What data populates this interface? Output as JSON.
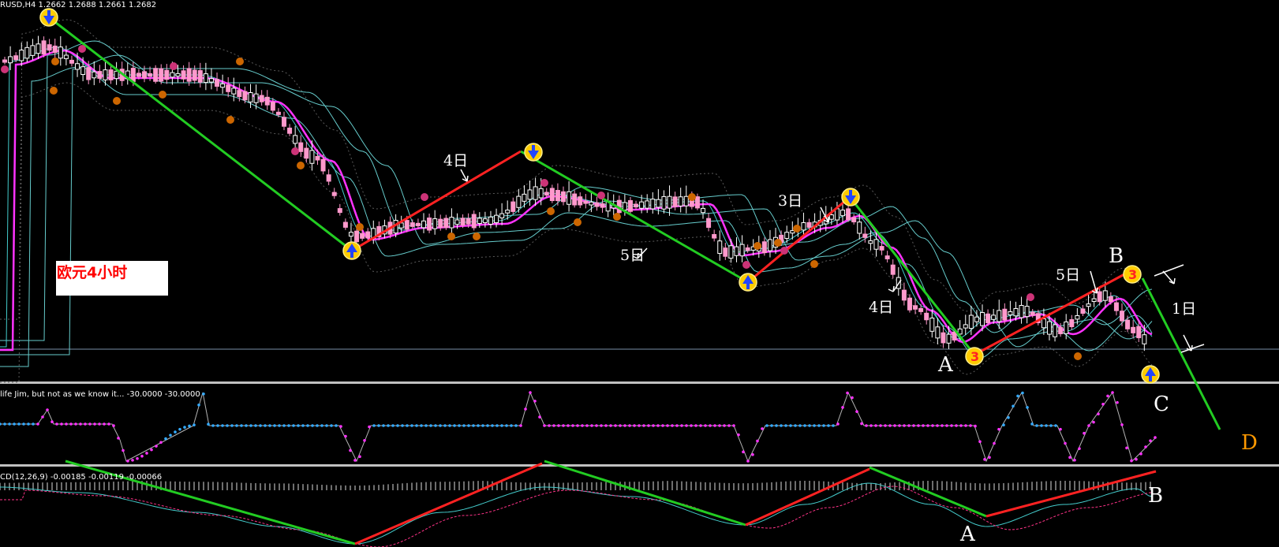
{
  "chart_data": [
    {
      "type": "candlestick",
      "header": "RUSD,H4  1.2662 1.2688 1.2661 1.2682",
      "annotations": [
        "4日",
        "5日",
        "3日",
        "4日",
        "5日",
        "1日"
      ],
      "wave_labels": [
        "A",
        "B",
        "C",
        "D"
      ],
      "chart_label": "欧元4小时"
    },
    {
      "type": "line",
      "header": "life Jim, but not as we know it...  -30.0000 -30.0000"
    },
    {
      "type": "bar",
      "header": "CD(12,26,9) -0.00185 -0.00119 -0.00066",
      "wave_labels": [
        "A",
        "B"
      ]
    }
  ],
  "colors": {
    "background": "#000000",
    "bull_candle": "#ffffff",
    "bear_candle": "#ff99cc",
    "ma_fast": "#ff33ff",
    "ma_slow": "#66cccc",
    "up_trend": "#ff2222",
    "down_trend": "#22cc22",
    "indicator_high": "#33aaff",
    "indicator_low": "#ff33ff",
    "d_label": "#ff9900"
  }
}
